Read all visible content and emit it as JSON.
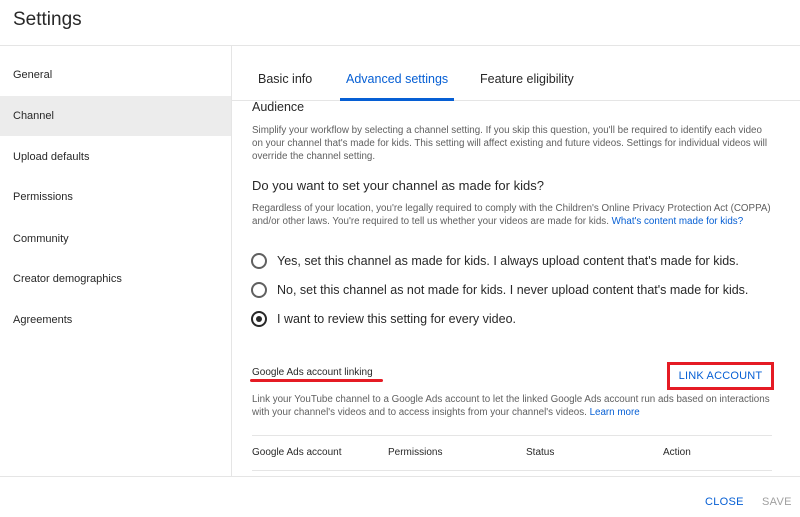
{
  "header": {
    "title": "Settings"
  },
  "sidebar": {
    "items": [
      {
        "label": "General"
      },
      {
        "label": "Channel"
      },
      {
        "label": "Upload defaults"
      },
      {
        "label": "Permissions"
      },
      {
        "label": "Community"
      },
      {
        "label": "Creator demographics"
      },
      {
        "label": "Agreements"
      }
    ],
    "active": "Channel"
  },
  "tabs": [
    {
      "label": "Basic info"
    },
    {
      "label": "Advanced settings"
    },
    {
      "label": "Feature eligibility"
    }
  ],
  "active_tab": "Advanced settings",
  "audience": {
    "title": "Audience",
    "description": "Simplify your workflow by selecting a channel setting. If you skip this question, you'll be required to identify each video on your channel that's made for kids. This setting will affect existing and future videos. Settings for individual videos will override the channel setting.",
    "question": "Do you want to set your channel as made for kids?",
    "coppa_text": "Regardless of your location, you're legally required to comply with the Children's Online Privacy Protection Act (COPPA) and/or other laws. You're required to tell us whether your videos are made for kids.",
    "coppa_link": "What's content made for kids?",
    "options": [
      {
        "label": "Yes, set this channel as made for kids. I always upload content that's made for kids.",
        "checked": false
      },
      {
        "label": "No, set this channel as not made for kids. I never upload content that's made for kids.",
        "checked": false
      },
      {
        "label": "I want to review this setting for every video.",
        "checked": true
      }
    ]
  },
  "ads": {
    "heading": "Google Ads account linking",
    "link_button": "LINK ACCOUNT",
    "description": "Link your YouTube channel to a Google Ads account to let the linked Google Ads account run ads based on interactions with your channel's videos and to access insights from your channel's videos.",
    "learn_more": "Learn more",
    "table_headers": [
      "Google Ads account",
      "Permissions",
      "Status",
      "Action"
    ]
  },
  "footer": {
    "close_label": "CLOSE",
    "save_label": "SAVE"
  },
  "colors": {
    "accent": "#065fd4",
    "highlight_red": "#e51b24",
    "active_nav_bg": "#ececec"
  }
}
